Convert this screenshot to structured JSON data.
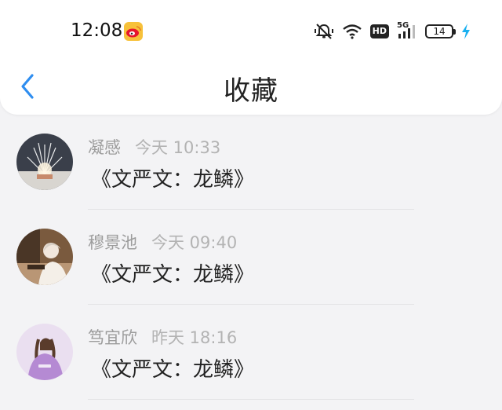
{
  "status_bar": {
    "time": "12:08",
    "network_label": "HD",
    "signal_label": "5G",
    "battery": "14"
  },
  "header": {
    "title": "收藏"
  },
  "items": [
    {
      "name": "凝感",
      "time": "今天 10:33",
      "content": "《文严文：龙鳞》"
    },
    {
      "name": "穆景池",
      "time": "今天 09:40",
      "content": "《文严文：龙鳞》"
    },
    {
      "name": "笃宜欣",
      "time": "昨天 18:16",
      "content": "《文严文：龙鳞》"
    }
  ],
  "colors": {
    "accent": "#2f8ef0",
    "charging": "#18b0f0",
    "background": "#f3f3f5"
  }
}
